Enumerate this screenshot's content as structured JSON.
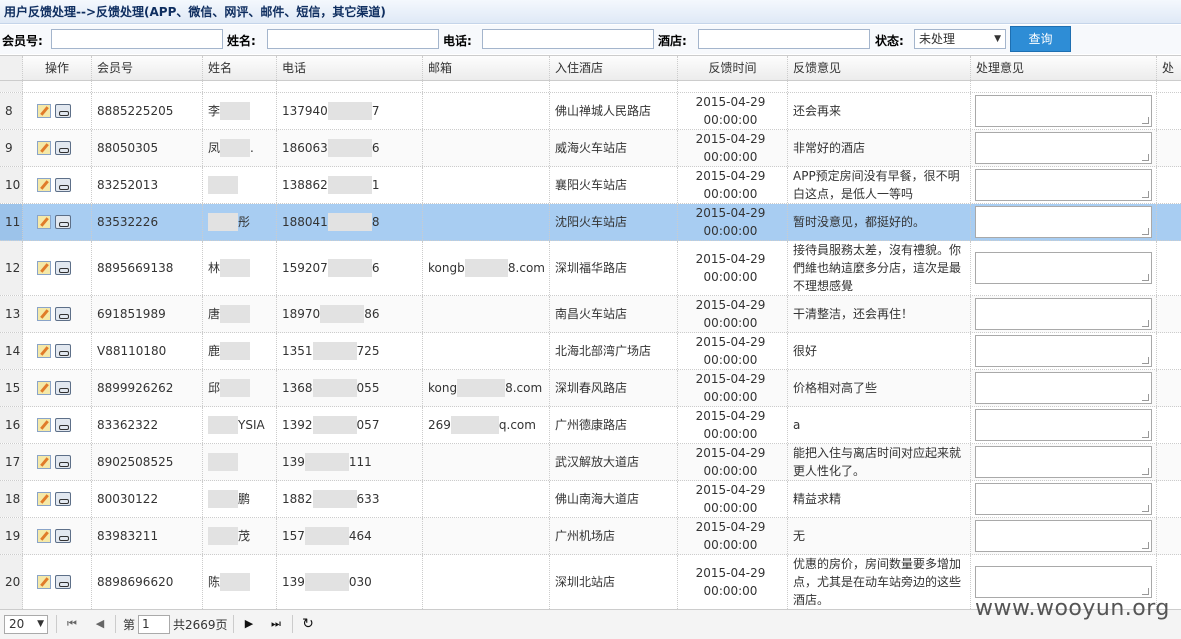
{
  "title": "用户反馈处理-->反馈处理(APP、微信、网评、邮件、短信，其它渠道)",
  "search": {
    "member_label": "会员号:",
    "name_label": "姓名:",
    "phone_label": "电话:",
    "hotel_label": "酒店:",
    "status_label": "状态:",
    "status_value": "未处理",
    "query_button": "查询"
  },
  "columns": [
    "操作",
    "会员号",
    "姓名",
    "电话",
    "邮箱",
    "入住酒店",
    "反馈时间",
    "反馈意见",
    "处理意见",
    "处"
  ],
  "rows": [
    {
      "n": "8",
      "member": "8885225205",
      "name": "李",
      "phone_a": "137940",
      "phone_b": "7",
      "email": "",
      "hotel": "佛山禅城人民路店",
      "date": "2015-04-29",
      "time": "00:00:00",
      "feedback": "还会再来"
    },
    {
      "n": "9",
      "member": "88050305",
      "name": "凤",
      "name_b": ".",
      "phone_a": "186063",
      "phone_b": "6",
      "email": "",
      "hotel": "威海火车站店",
      "date": "2015-04-29",
      "time": "00:00:00",
      "feedback": "非常好的酒店"
    },
    {
      "n": "10",
      "member": "83252013",
      "name": "",
      "phone_a": "138862",
      "phone_b": "1",
      "email": "",
      "hotel": "襄阳火车站店",
      "date": "2015-04-29",
      "time": "00:00:00",
      "feedback": "APP预定房间没有早餐，很不明白这点，是低人一等吗"
    },
    {
      "n": "11",
      "member": "83532226",
      "name": "",
      "name_b": "彤",
      "phone_a": "188041",
      "phone_b": "8",
      "email": "",
      "hotel": "沈阳火车站店",
      "date": "2015-04-29",
      "time": "00:00:00",
      "feedback": "暂时没意见，都挺好的。"
    },
    {
      "n": "12",
      "member": "8895669138",
      "name": "林",
      "phone_a": "159207",
      "phone_b": "6",
      "email_a": "kongb",
      "email_b": "8.com",
      "hotel": "深圳福华路店",
      "date": "2015-04-29",
      "time": "00:00:00",
      "feedback": "接待員服務太差，沒有禮貌。你們維也納這麼多分店，這次是最不理想感覺"
    },
    {
      "n": "13",
      "member": "691851989",
      "name": "唐",
      "phone_a": "18970",
      "phone_b": "86",
      "email": "",
      "hotel": "南昌火车站店",
      "date": "2015-04-29",
      "time": "00:00:00",
      "feedback": "干清整洁，还会再住！"
    },
    {
      "n": "14",
      "member": "V88110180",
      "name": "鹿",
      "phone_a": "1351",
      "phone_b": "725",
      "email": "",
      "hotel": "北海北部湾广场店",
      "date": "2015-04-29",
      "time": "00:00:00",
      "feedback": "很好"
    },
    {
      "n": "15",
      "member": "8899926262",
      "name": "邱",
      "phone_a": "1368",
      "phone_b": "055",
      "email_a": "kong",
      "email_b": "8.com",
      "hotel": "深圳春风路店",
      "date": "2015-04-29",
      "time": "00:00:00",
      "feedback": "价格相对高了些"
    },
    {
      "n": "16",
      "member": "83362322",
      "name": "",
      "name_b": "YSIA",
      "phone_a": "1392",
      "phone_b": "057",
      "email_a": "269",
      "email_b": "q.com",
      "hotel": "广州德康路店",
      "date": "2015-04-29",
      "time": "00:00:00",
      "feedback": "a"
    },
    {
      "n": "17",
      "member": "8902508525",
      "name": "",
      "phone_a": "139",
      "phone_b": "111",
      "email": "",
      "hotel": "武汉解放大道店",
      "date": "2015-04-29",
      "time": "00:00:00",
      "feedback": "能把入住与离店时间对应起来就更人性化了。"
    },
    {
      "n": "18",
      "member": "80030122",
      "name": "",
      "name_b": "鹏",
      "phone_a": "1882",
      "phone_b": "633",
      "email": "",
      "hotel": "佛山南海大道店",
      "date": "2015-04-29",
      "time": "00:00:00",
      "feedback": "精益求精"
    },
    {
      "n": "19",
      "member": "83983211",
      "name": "",
      "name_b": "茂",
      "phone_a": "157",
      "phone_b": "464",
      "email": "",
      "hotel": "广州机场店",
      "date": "2015-04-29",
      "time": "00:00:00",
      "feedback": "无"
    },
    {
      "n": "20",
      "member": "8898696620",
      "name": "陈",
      "phone_a": "139",
      "phone_b": "030",
      "email": "",
      "hotel": "深圳北站店",
      "date": "2015-04-29",
      "time": "00:00:00",
      "feedback": "优惠的房价，房间数量要多增加点，尤其是在动车站旁边的这些酒店。"
    }
  ],
  "pager": {
    "page_size": "20",
    "page_prefix": "第",
    "page_value": "1",
    "page_total": "共2669页"
  },
  "watermark": "www.wooyun.org"
}
